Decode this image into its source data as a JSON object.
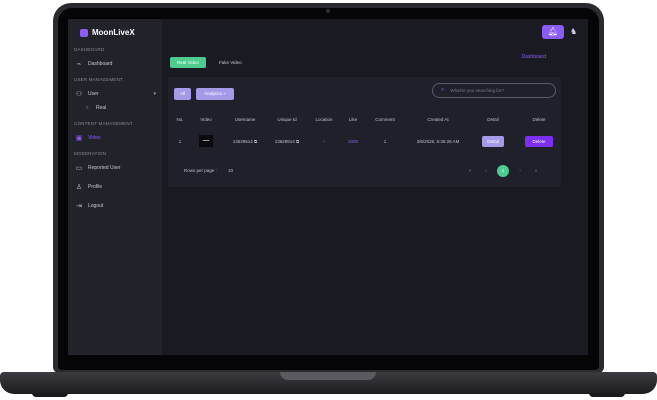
{
  "app": {
    "brand": "MoonLiveX",
    "accent": "#8b5cf6",
    "success": "#4ecb8f"
  },
  "sidebar": {
    "sections": [
      "DASHBOARD",
      "USER MANAGEMENT",
      "CONTENT MANAGEMENT",
      "MODERATION"
    ],
    "items": [
      {
        "label": "Dashboard",
        "icon": "pulse-icon"
      },
      {
        "label": "User",
        "icon": "users-icon"
      },
      {
        "label": "Real",
        "icon": "circle-icon"
      },
      {
        "label": "Video",
        "icon": "video-icon"
      },
      {
        "label": "Reported User",
        "icon": "chat-icon"
      },
      {
        "label": "Profile",
        "icon": "person-icon"
      },
      {
        "label": "Logout",
        "icon": "logout-icon"
      }
    ]
  },
  "header": {
    "dashboard_link": "Dashboard"
  },
  "tabs": [
    "Real Video",
    "Fake Video"
  ],
  "toolbar": {
    "all_label": "All",
    "analytics_label": "Analytics »",
    "search_placeholder": "What're you searching for?"
  },
  "table": {
    "columns": [
      "No.",
      "Video",
      "Username",
      "Unique Id",
      "Location",
      "Like",
      "Comment",
      "Created At",
      "Detail",
      "Delete"
    ],
    "rows": [
      {
        "no": "1",
        "username": "13629514",
        "unique_id": "13629514",
        "location": "-",
        "like": "1000",
        "comment": "1",
        "created_at": "3/6/2026, 6:35:26 AM",
        "detail": "Detail",
        "delete": "Delete"
      }
    ]
  },
  "pagination": {
    "rows_per_page_label": "Rows per page :",
    "rows_per_page": "10",
    "first": "«",
    "prev": "‹",
    "current": "1",
    "next": "›",
    "last": "»"
  }
}
